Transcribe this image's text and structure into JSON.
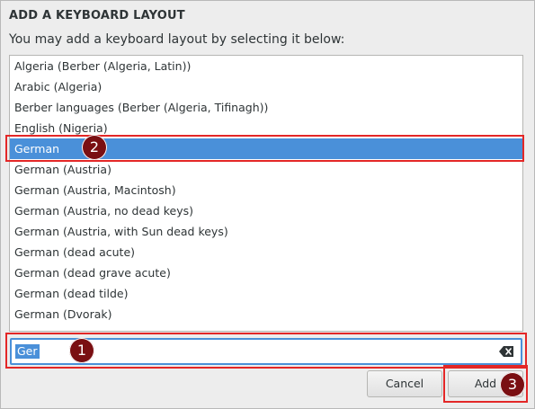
{
  "dialog": {
    "title": "ADD A KEYBOARD LAYOUT",
    "subtitle": "You may add a keyboard layout by selecting it below:"
  },
  "layouts": [
    {
      "label": "Algeria (Berber (Algeria, Latin))"
    },
    {
      "label": "Arabic (Algeria)"
    },
    {
      "label": "Berber languages (Berber (Algeria, Tifinagh))"
    },
    {
      "label": "English (Nigeria)"
    },
    {
      "label": "German",
      "selected": true
    },
    {
      "label": "German (Austria)"
    },
    {
      "label": "German (Austria, Macintosh)"
    },
    {
      "label": "German (Austria, no dead keys)"
    },
    {
      "label": "German (Austria, with Sun dead keys)"
    },
    {
      "label": "German (dead acute)"
    },
    {
      "label": "German (dead grave acute)"
    },
    {
      "label": "German (dead tilde)"
    },
    {
      "label": "German (Dvorak)"
    }
  ],
  "search": {
    "value": "Ger",
    "clear_icon": "backspace-clear-icon"
  },
  "buttons": {
    "cancel": "Cancel",
    "add": "Add"
  },
  "annotations": {
    "badge1": "1",
    "badge2": "2",
    "badge3": "3",
    "color": "#e32727",
    "badge_color": "#7a0f12"
  },
  "colors": {
    "accent": "#4a90d9",
    "background": "#ededed"
  }
}
